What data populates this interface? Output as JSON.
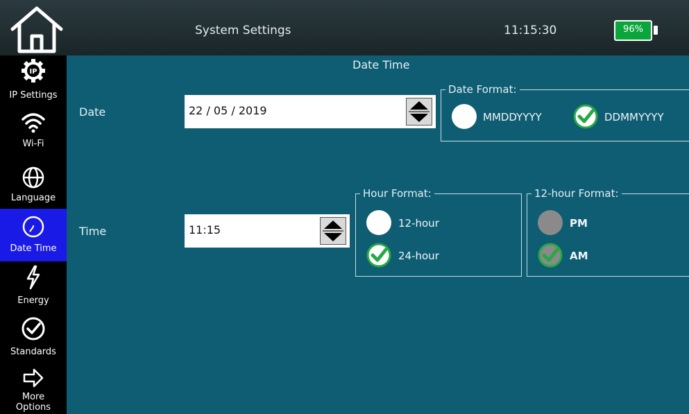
{
  "header": {
    "title": "System Settings",
    "clock": "11:15:30",
    "battery_level": "96%",
    "battery_color": "#0aa63c",
    "home_icon": "home-icon"
  },
  "sidebar": {
    "items": [
      {
        "label": "IP Settings",
        "icon": "ip-gear-icon",
        "active": false
      },
      {
        "label": "Wi-Fi",
        "icon": "wifi-icon",
        "active": false
      },
      {
        "label": "Language",
        "icon": "globe-icon",
        "active": false
      },
      {
        "label": "Date Time",
        "icon": "clock-icon",
        "active": true
      },
      {
        "label": "Energy",
        "icon": "lightning-icon",
        "active": false
      },
      {
        "label": "Standards",
        "icon": "check-circle-icon",
        "active": false
      },
      {
        "label": "More Options",
        "label_line1": "More",
        "label_line2": "Options",
        "icon": "arrow-right-icon",
        "active": false
      }
    ]
  },
  "main": {
    "section_title": "Date Time",
    "date": {
      "label": "Date",
      "value": "22 / 05 / 2019",
      "format_group": {
        "legend": "Date Format:",
        "options": [
          {
            "label": "MMDDYYYY",
            "selected": false
          },
          {
            "label": "DDMMYYYY",
            "selected": true
          }
        ]
      }
    },
    "time": {
      "label": "Time",
      "value": "11:15",
      "hour_format_group": {
        "legend": "Hour Format:",
        "options": [
          {
            "label": "12-hour",
            "selected": false
          },
          {
            "label": "24-hour",
            "selected": true
          }
        ]
      },
      "twelve_hour_group": {
        "legend": "12-hour Format:",
        "disabled": true,
        "options": [
          {
            "label": "PM",
            "selected": false
          },
          {
            "label": "AM",
            "selected": true
          }
        ]
      }
    }
  },
  "colors": {
    "panel_bg": "#0e5d73",
    "active_nav": "#1a1ae6",
    "check_green": "#27a844"
  }
}
